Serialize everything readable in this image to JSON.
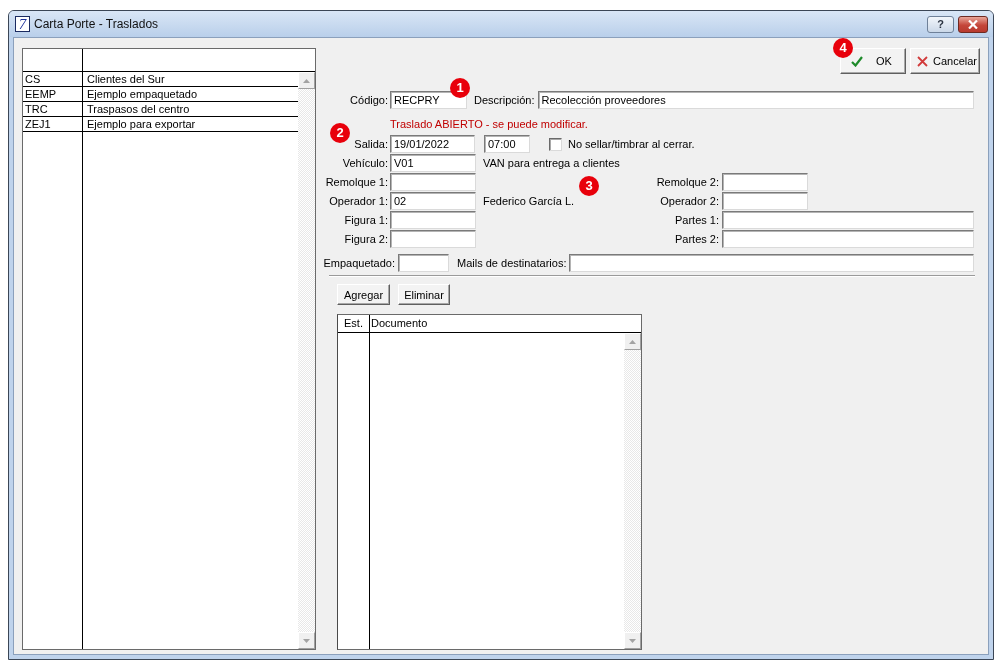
{
  "window": {
    "icon_glyph": "7",
    "title": "Carta Porte - Traslados",
    "help_button": "?"
  },
  "record_list": {
    "rows": [
      {
        "code": "CS",
        "description": "Clientes del Sur",
        "selected": false
      },
      {
        "code": "EEMP",
        "description": "Ejemplo empaquetado",
        "selected": false
      },
      {
        "code": "TRC",
        "description": "Traspasos del centro",
        "selected": false
      },
      {
        "code": "ZEJ1",
        "description": "Ejemplo para exportar",
        "selected": false
      }
    ]
  },
  "actions": [
    {
      "label": "OK",
      "kind": "confirm"
    },
    {
      "label": "Cancelar",
      "kind": "cancel"
    }
  ],
  "form": {
    "code": {
      "label": "Código:",
      "value": "RECPRY"
    },
    "description": {
      "label": "Descripción:",
      "value": "Recolección proveedores"
    },
    "status_message": "Traslado ABIERTO - se puede modificar.",
    "departure": {
      "label": "Salida:",
      "date": "19/01/2022",
      "time": "07:00"
    },
    "no_stamp": {
      "label": "No sellar/timbrar al cerrar.",
      "checked": false
    },
    "vehicle": {
      "label": "Vehículo:",
      "value": "V01",
      "description": "VAN para entrega a clientes"
    },
    "trailer_1": {
      "label": "Remolque 1:"
    },
    "trailer_2": {
      "label": "Remolque 2:"
    },
    "operator_1": {
      "label": "Operador 1:",
      "value": "02",
      "description": "Federico García L."
    },
    "operator_2": {
      "label": "Operador 2:"
    },
    "figure_1": {
      "label": "Figura 1:"
    },
    "parts_1": {
      "label": "Partes 1:"
    },
    "figure_2": {
      "label": "Figura 2:"
    },
    "parts_2": {
      "label": "Partes 2:"
    },
    "packaged": {
      "label": "Empaquetado:"
    },
    "emails": {
      "label": "Mails de destinatarios:"
    }
  },
  "document_buttons": [
    "Agregar",
    "Eliminar"
  ],
  "documents_table": {
    "columns": [
      "Est.",
      "Documento"
    ]
  },
  "annotation_markers": [
    {
      "label": "1"
    },
    {
      "label": "2"
    },
    {
      "label": "3"
    },
    {
      "label": "4"
    }
  ]
}
